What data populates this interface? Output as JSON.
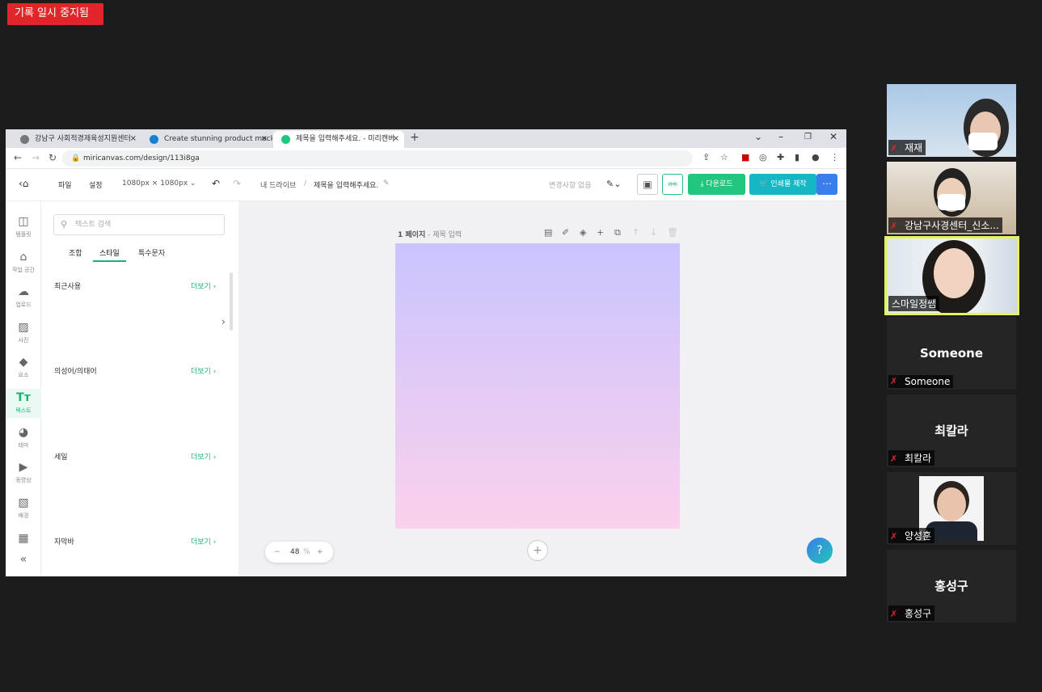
{
  "recording_badge": "기록 일시 중지됨",
  "browser": {
    "tabs": [
      {
        "label": "강남구 사회적경제육성지원센터",
        "close": "×"
      },
      {
        "label": "Create stunning product mocku",
        "close": "×"
      },
      {
        "label": "제목을 입력해주세요. - 미리캔버",
        "close": "×"
      }
    ],
    "new_tab": "+",
    "url": "miricanvas.com/design/113i8ga"
  },
  "app": {
    "menu_file": "파일",
    "menu_settings": "설정",
    "canvas_size": "1080px × 1080px",
    "breadcrumb_drive": "내 드라이브",
    "breadcrumb_sep": "/",
    "doc_title": "제목을 입력해주세요.",
    "status": "변경사항 없음",
    "download": "다운로드",
    "print": "인쇄물 제작"
  },
  "leftnav": [
    {
      "icon": "template-icon",
      "label": "템플릿"
    },
    {
      "icon": "workspace-icon",
      "label": "작업 공간"
    },
    {
      "icon": "upload-icon",
      "label": "업로드"
    },
    {
      "icon": "photo-icon",
      "label": "사진"
    },
    {
      "icon": "elements-icon",
      "label": "요소"
    },
    {
      "icon": "text-icon",
      "label": "텍스트"
    },
    {
      "icon": "theme-icon",
      "label": "테마"
    },
    {
      "icon": "video-icon",
      "label": "동영상"
    },
    {
      "icon": "background-icon",
      "label": "배경"
    }
  ],
  "panel": {
    "search_placeholder": "텍스트 검색",
    "tabs": [
      "조합",
      "스타일",
      "특수문자"
    ],
    "active_tab": "스타일",
    "sections": [
      {
        "title": "최근사용",
        "more": "더보기 ›"
      },
      {
        "title": "의성어/의태어",
        "more": "더보기 ›"
      },
      {
        "title": "세일",
        "more": "더보기 ›"
      },
      {
        "title": "자막바",
        "more": "더보기 ›"
      }
    ]
  },
  "canvas": {
    "page_label": "1 페이지",
    "page_title_placeholder": "- 제목 입력",
    "zoom_value": "48",
    "zoom_unit": "%",
    "gradient_top": "#c9c4fe",
    "gradient_bottom": "#fbd1ec"
  },
  "participants": [
    {
      "name": "재재",
      "muted": true,
      "video": true
    },
    {
      "name": "강남구사경센터_신소...",
      "muted": true,
      "video": true
    },
    {
      "name": "스마일정쌤",
      "muted": false,
      "video": true,
      "active_speaker": true
    },
    {
      "name": "Someone",
      "muted": true,
      "video": false,
      "display": "Someone"
    },
    {
      "name": "최칼라",
      "muted": true,
      "video": false,
      "display": "최칼라"
    },
    {
      "name": "양성훈",
      "muted": true,
      "video": true
    },
    {
      "name": "홍성구",
      "muted": true,
      "video": false,
      "display": "홍성구"
    }
  ],
  "colors": {
    "accent_green": "#21c67e",
    "print_teal": "#13b8c4",
    "record_red": "#e0262a",
    "speaker_highlight": "#e6f25a"
  }
}
